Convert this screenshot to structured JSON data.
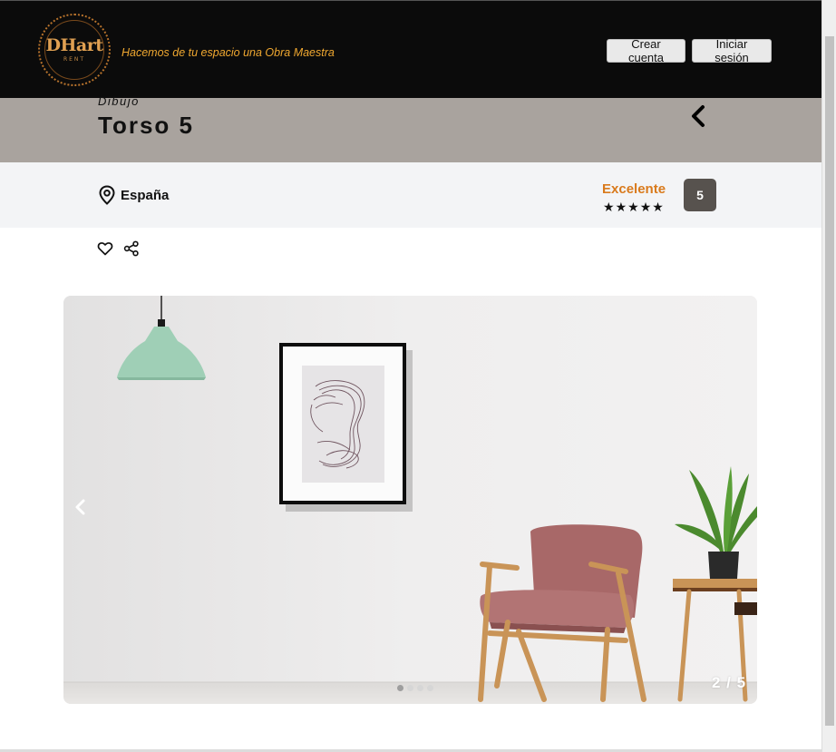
{
  "header": {
    "logo_text": "DHart",
    "logo_sub": "RENT",
    "tagline": "Hacemos de tu espacio una Obra Maestra",
    "create_account_label": "Crear cuenta",
    "login_label": "Iniciar sesión"
  },
  "artwork": {
    "category": "Dibujo",
    "title": "Torso 5"
  },
  "info": {
    "location": "España",
    "rating_label": "Excelente",
    "stars": 5,
    "score": "5"
  },
  "gallery": {
    "counter": "2 / 5",
    "current_index": 2,
    "total": 5
  },
  "colors": {
    "header_bg": "#0b0b0b",
    "accent_orange": "#d97a1c",
    "title_band": "#a9a39e",
    "score_badge": "#57524e"
  },
  "icons": [
    "back-chevron-icon",
    "location-pin-icon",
    "heart-icon",
    "share-icon",
    "prev-arrow-icon"
  ]
}
